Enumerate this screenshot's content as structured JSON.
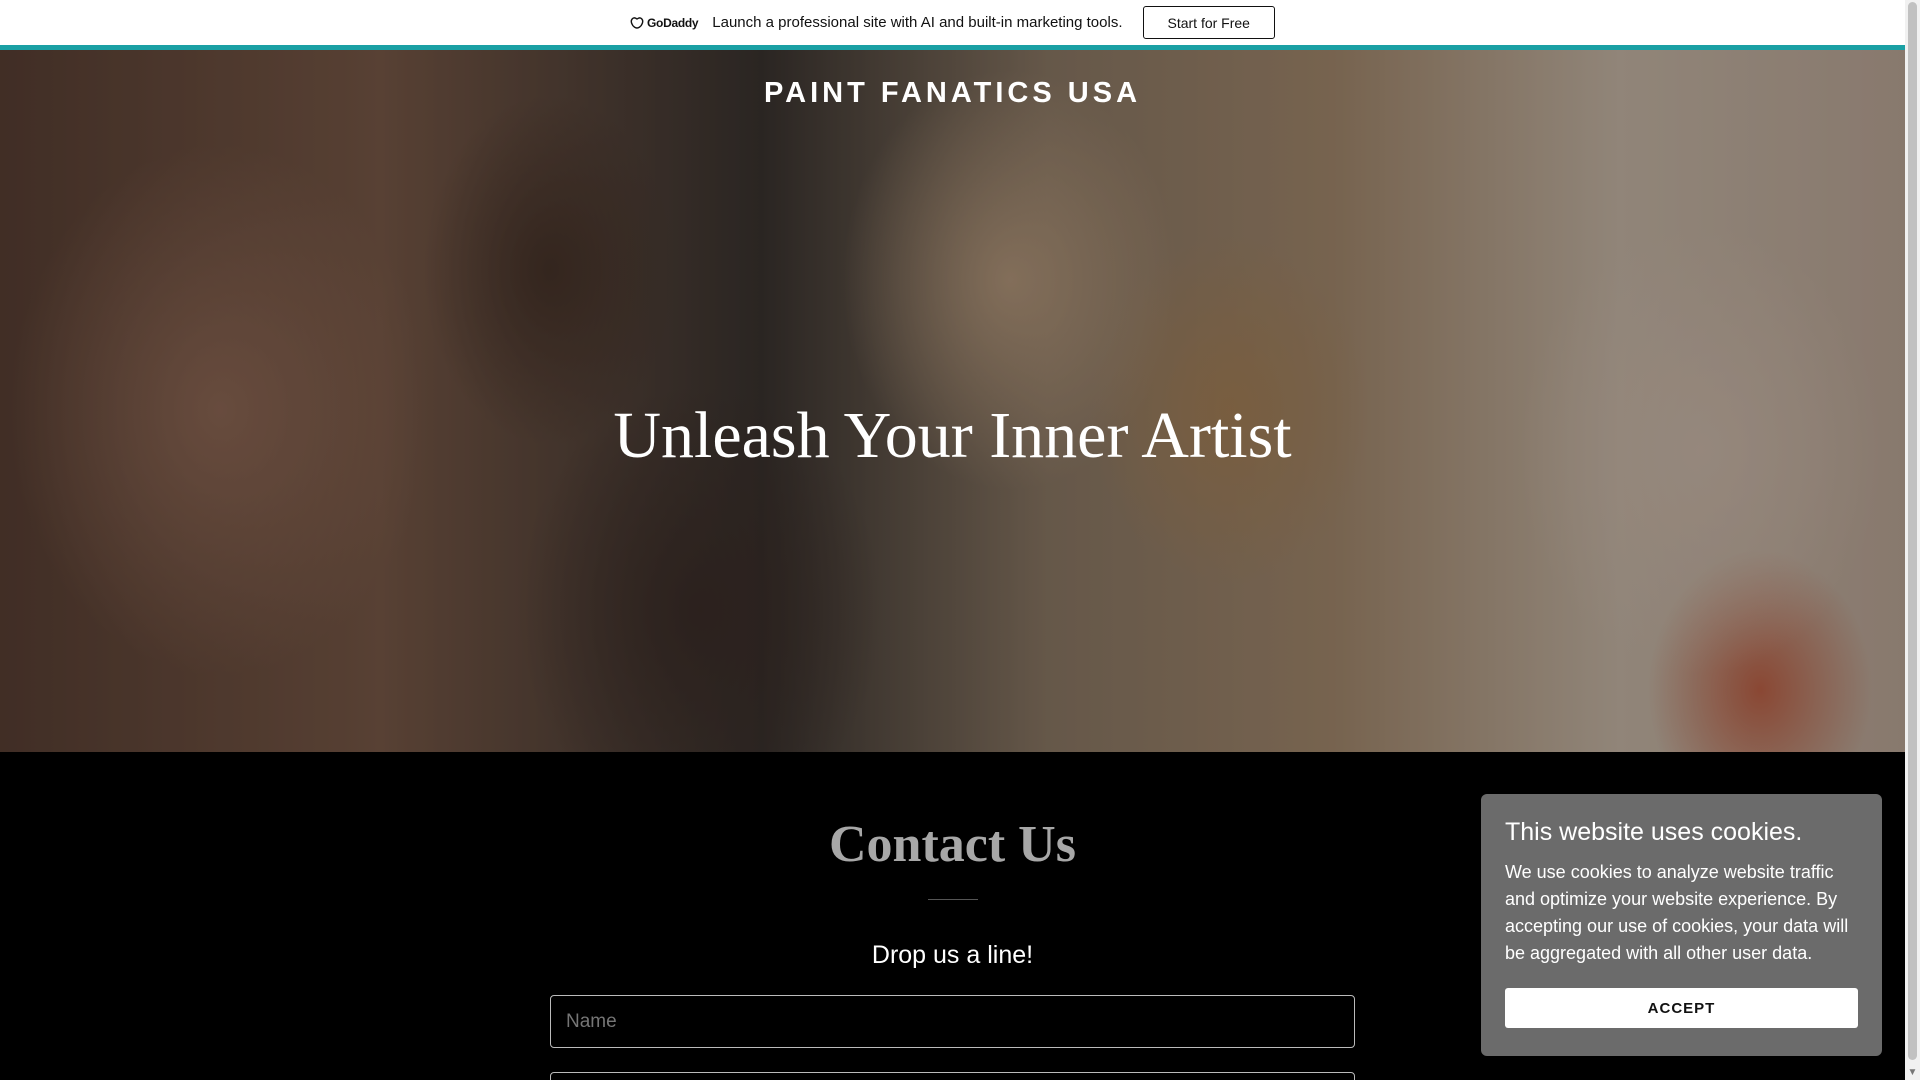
{
  "promo": {
    "brand": "GoDaddy",
    "text": "Launch a professional site with AI and built-in marketing tools.",
    "cta_label": "Start for Free"
  },
  "hero": {
    "site_title": "PAINT FANATICS USA",
    "heading": "Unleash Your Inner Artist"
  },
  "contact": {
    "title": "Contact Us",
    "subtitle": "Drop us a line!",
    "name_placeholder": "Name"
  },
  "cookie": {
    "title": "This website uses cookies.",
    "body": "We use cookies to analyze website traffic and optimize your website experience. By accepting our use of cookies, your data will be aggregated with all other user data.",
    "accept_label": "ACCEPT"
  },
  "colors": {
    "accent_line": "#1aa0a4",
    "cookie_bg": "#6b6b6b"
  }
}
